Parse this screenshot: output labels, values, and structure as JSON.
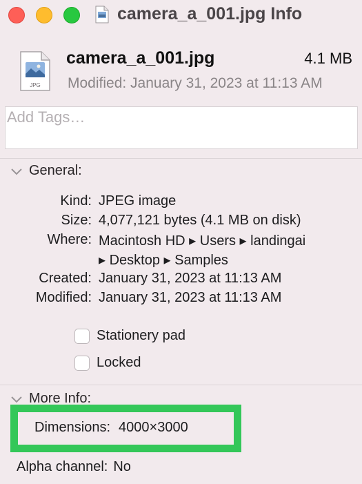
{
  "window": {
    "title": "camera_a_001.jpg Info"
  },
  "header": {
    "file_name": "camera_a_001.jpg",
    "file_size": "4.1 MB",
    "modified": "Modified: January 31, 2023 at 11:13 AM",
    "file_icon": "jpg-file-icon",
    "file_icon_caption": "JPG"
  },
  "tags": {
    "placeholder": "Add Tags…"
  },
  "general": {
    "label": "General:",
    "rows": [
      {
        "label": "Kind:",
        "value": "JPEG image"
      },
      {
        "label": "Size:",
        "value": "4,077,121 bytes (4.1 MB on disk)"
      },
      {
        "label": "Where:",
        "value": "Macintosh HD ▸ Users ▸ landingai"
      },
      {
        "label": "",
        "value": "▸ Desktop ▸ Samples"
      },
      {
        "label": "Created:",
        "value": "January 31, 2023 at 11:13 AM"
      },
      {
        "label": "Modified:",
        "value": "January 31, 2023 at 11:13 AM"
      }
    ],
    "stationery_pad": {
      "label": "Stationery pad",
      "checked": false
    },
    "locked": {
      "label": "Locked",
      "checked": false
    }
  },
  "more_info": {
    "label": "More Info:",
    "dimensions": {
      "label": "Dimensions:",
      "value": "4000×3000"
    },
    "alpha_channel": {
      "label": "Alpha channel:",
      "value": "No"
    }
  },
  "colors": {
    "highlight": "#34c759",
    "background": "#f2eaed",
    "close": "#fe5f57",
    "minimize": "#febc2e",
    "zoom": "#28c840"
  }
}
